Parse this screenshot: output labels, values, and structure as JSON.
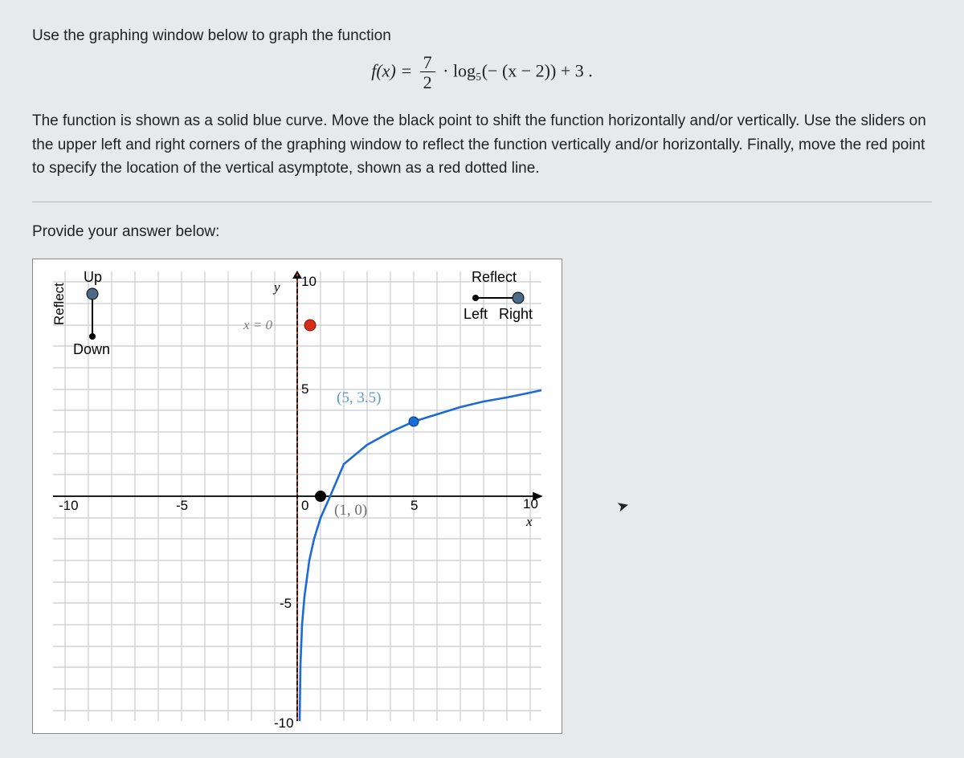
{
  "instruction_line1": "Use the graphing window below to graph the function",
  "formula": {
    "lhs": "f(x) =",
    "frac_num": "7",
    "frac_den": "2",
    "dot": "·",
    "rhs": "log₅(− (x − 2)) + 3 ."
  },
  "instruction_para": "The function is shown as a solid blue curve. Move the black point to shift the function horizontally and/or vertically. Use the sliders on the upper left and right corners of the graphing window to reflect the function vertically and/or horizontally. Finally, move the red point to specify the location of the vertical asymptote, shown as a red dotted line.",
  "answer_label": "Provide your answer below:",
  "graph": {
    "ylabel_rot": "Reflect",
    "up": "Up",
    "down": "Down",
    "reflect": "Reflect",
    "left": "Left",
    "right": "Right",
    "ticks": {
      "xmin": "-10",
      "xminus5": "-5",
      "zero": "0",
      "x5": "5",
      "x10": "10",
      "y10": "10",
      "y5": "5",
      "yminus5": "-5",
      "yminus10": "-10"
    },
    "ylabel": "y",
    "xlabel": "x",
    "asymptote_label": "x = 0",
    "pt_upper": "(5, 3.5)",
    "pt_lower": "(1, 0)",
    "x_axis_range": [
      -10.5,
      10.5
    ],
    "y_axis_range": [
      -10.5,
      10.5
    ],
    "curve_note": "y = (7/2)·log5(x) for x>0, asymptote at x=0, black point at (1,0), blue point at (5,3.5)"
  },
  "chart_data": {
    "type": "line",
    "title": "",
    "xlabel": "x",
    "ylabel": "y",
    "xlim": [
      -10.5,
      10.5
    ],
    "ylim": [
      -10.5,
      10.5
    ],
    "asymptote_x": 0,
    "series": [
      {
        "name": "f(x)",
        "color": "#1a6bd6",
        "x": [
          0.05,
          0.1,
          0.2,
          0.5,
          1,
          2,
          3,
          5,
          7,
          10
        ],
        "y": [
          -6.51,
          -5.01,
          -3.5,
          -1.51,
          0,
          1.51,
          2.39,
          3.5,
          4.23,
          5.01
        ]
      }
    ],
    "points": [
      {
        "name": "black-translate-point",
        "x": 1,
        "y": 0,
        "color": "#000"
      },
      {
        "name": "blue-curve-point",
        "x": 5,
        "y": 3.5,
        "color": "#1a6bd6"
      },
      {
        "name": "red-asymptote-point",
        "x": 0,
        "y": 8,
        "color": "#d62c1a"
      }
    ]
  }
}
